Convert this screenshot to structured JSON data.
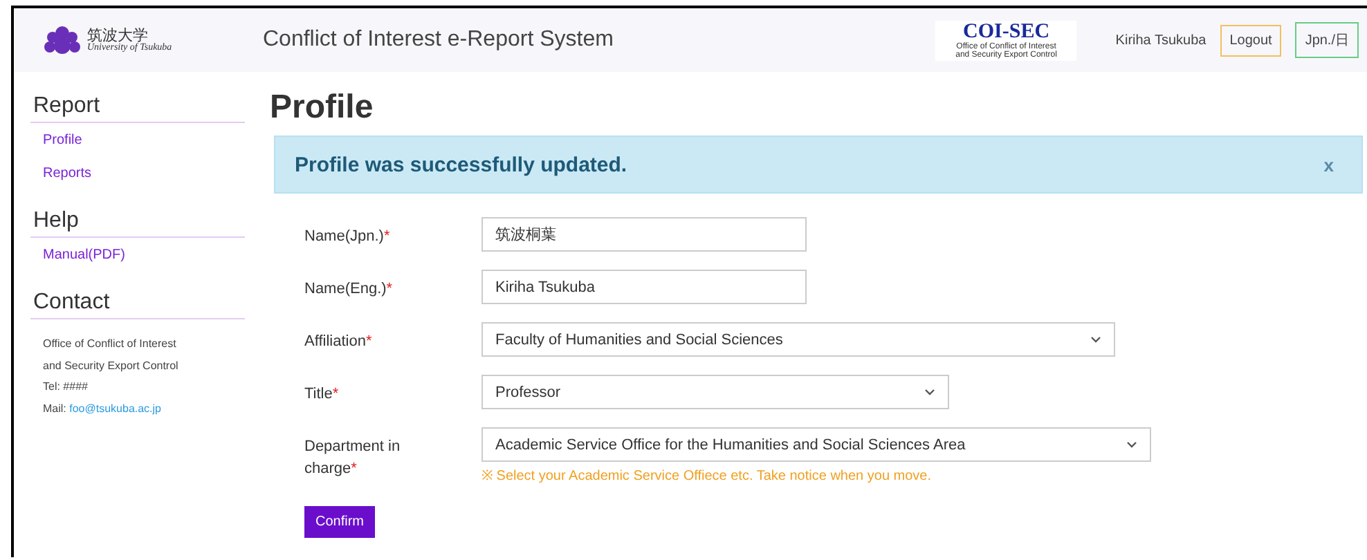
{
  "header": {
    "logo": {
      "name_jp": "筑波大学",
      "name_en": "University of Tsukuba"
    },
    "title": "Conflict of Interest e-Report System",
    "badge": {
      "title": "COI-SEC",
      "subtitle": [
        "Office of Conflict of Interest",
        "and Security Export Control"
      ]
    },
    "user": "Kiriha Tsukuba",
    "buttons": [
      {
        "label": "Logout",
        "color": "#f0c060"
      },
      {
        "label": "Jpn./日",
        "color": "#66cc88"
      }
    ]
  },
  "sidebar": {
    "sections": [
      {
        "heading": "Report",
        "links": [
          "Profile",
          "Reports"
        ]
      },
      {
        "heading": "Help",
        "links": [
          "Manual(PDF)"
        ]
      },
      {
        "heading": "Contact",
        "lines": [
          "Office of Conflict of Interest",
          "and Security Export Control",
          "Tel: ####"
        ],
        "mail_label": "Mail:",
        "mail": "foo@tsukuba.ac.jp"
      }
    ]
  },
  "page_title": "Profile",
  "alert": {
    "message": "Profile was successfully updated.",
    "close": "x"
  },
  "form": {
    "fields": [
      {
        "label": "Name(Jpn.)",
        "required_mark": "*",
        "kind": "text",
        "value": "筑波桐葉"
      },
      {
        "label": "Name(Eng.)",
        "required_mark": "*",
        "kind": "text",
        "value": "Kiriha Tsukuba"
      },
      {
        "label": "Affiliation",
        "required_mark": "*",
        "kind": "select",
        "value": "Faculty of Humanities and Social Sciences"
      },
      {
        "label": "Title",
        "required_mark": "*",
        "kind": "select",
        "value": "Professor"
      },
      {
        "label": "Department in charge",
        "required_mark": "*",
        "kind": "select",
        "value": "Academic Service Office for the Humanities and Social Sciences Area",
        "hint": "※ Select your Academic Service Offiece etc. Take notice when you move."
      }
    ],
    "submit": "Confirm"
  }
}
